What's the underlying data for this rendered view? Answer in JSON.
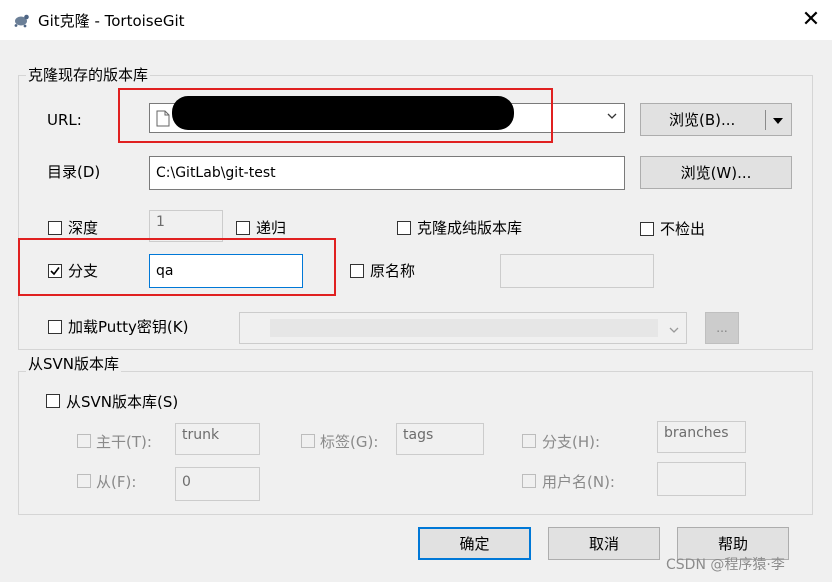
{
  "window": {
    "title": "Git克隆 - TortoiseGit"
  },
  "clone_group": {
    "label": "克隆现存的版本库",
    "url_label": "URL:",
    "url_value": "",
    "browse_url_label": "浏览(B)...",
    "dir_label": "目录(D)",
    "dir_value": "C:\\GitLab\\git-test",
    "browse_dir_label": "浏览(W)...",
    "depth_label": "深度",
    "depth_value": "1",
    "recursive_label": "递归",
    "bare_label": "克隆成纯版本库",
    "no_checkout_label": "不检出",
    "branch_label": "分支",
    "branch_checked": true,
    "branch_value": "qa",
    "origin_name_label": "原名称",
    "load_putty_label": "加载Putty密钥(K)",
    "putty_browse_label": "..."
  },
  "svn_group": {
    "label": "从SVN版本库",
    "from_svn_label": "从SVN版本库(S)",
    "trunk_label": "主干(T):",
    "trunk_value": "trunk",
    "tags_label": "标签(G):",
    "tags_value": "tags",
    "branch_label": "分支(H):",
    "branch_value": "branches",
    "from_label": "从(F):",
    "from_value": "0",
    "username_label": "用户名(N):"
  },
  "buttons": {
    "ok": "确定",
    "cancel": "取消",
    "help": "帮助"
  },
  "watermark": "CSDN @程序猿·李"
}
